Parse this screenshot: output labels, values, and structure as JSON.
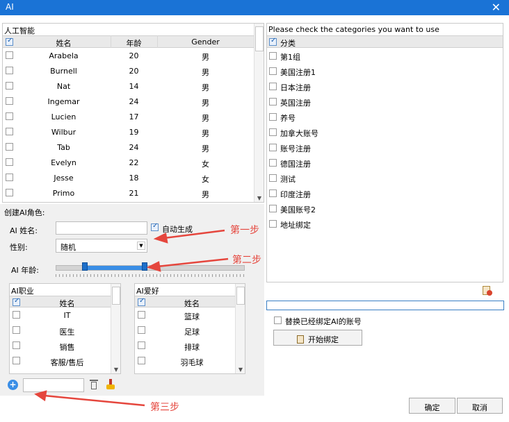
{
  "window": {
    "title": "AI"
  },
  "people": {
    "caption": "人工智能",
    "headers": [
      "姓名",
      "年龄",
      "Gender"
    ],
    "rows": [
      [
        "Arabela",
        "20",
        "男"
      ],
      [
        "Burnell",
        "20",
        "男"
      ],
      [
        "Nat",
        "14",
        "男"
      ],
      [
        "Ingemar",
        "24",
        "男"
      ],
      [
        "Lucien",
        "17",
        "男"
      ],
      [
        "Wilbur",
        "19",
        "男"
      ],
      [
        "Tab",
        "24",
        "男"
      ],
      [
        "Evelyn",
        "22",
        "女"
      ],
      [
        "Jesse",
        "18",
        "女"
      ],
      [
        "Primo",
        "21",
        "男"
      ]
    ]
  },
  "create": {
    "section_label": "创建AI角色:",
    "name_label": "AI 姓名:",
    "name_value": "",
    "auto_label": "自动生成",
    "gender_label": "性别:",
    "gender_value": "随机",
    "age_label": "AI 年龄:",
    "age_range_fraction": [
      0.15,
      0.47
    ]
  },
  "jobs": {
    "caption": "AI职业",
    "header": "姓名",
    "items": [
      "IT",
      "医生",
      "销售",
      "客服/售后"
    ]
  },
  "hobbies": {
    "caption": "AI爱好",
    "header": "姓名",
    "items": [
      "篮球",
      "足球",
      "排球",
      "羽毛球"
    ]
  },
  "bottom_input": {
    "value": ""
  },
  "categories": {
    "caption": "Please check the categories you want to use",
    "header": "分类",
    "items": [
      "第1组",
      "美国注册1",
      "日本注册",
      "英国注册",
      "养号",
      "加拿大账号",
      "账号注册",
      "德国注册",
      "测试",
      "印度注册",
      "美国账号2",
      "地址绑定"
    ]
  },
  "binding": {
    "replace_label": "替换已经绑定AI的账号",
    "start_label": "开始绑定",
    "progress_value": ""
  },
  "footer": {
    "ok": "确定",
    "cancel": "取消"
  },
  "annotations": {
    "step1": "第一步",
    "step2": "第二步",
    "step3": "第三步"
  },
  "colors": {
    "titlebar": "#1a73d6",
    "arrow": "#e5463d",
    "slider": "#3a8ee6"
  }
}
